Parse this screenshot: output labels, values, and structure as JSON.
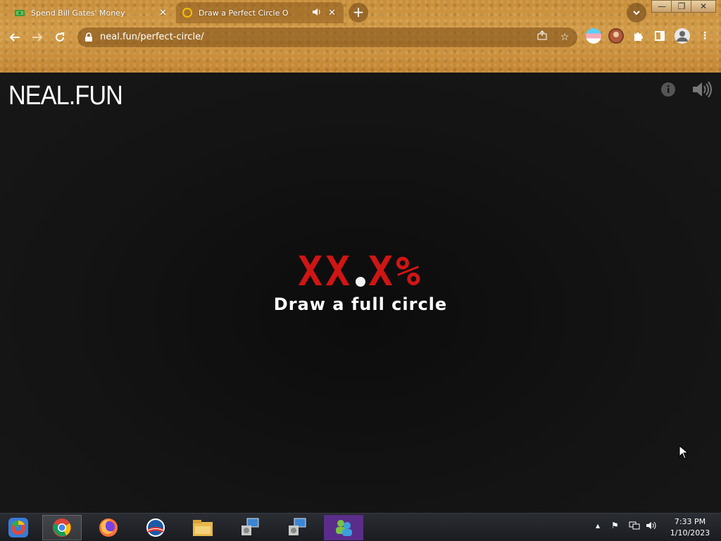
{
  "browser": {
    "tabs": [
      {
        "title": "Spend Bill Gates' Money",
        "close": "✕"
      },
      {
        "title": "Draw a Perfect Circle O",
        "close": "✕"
      }
    ],
    "new_tab": "+",
    "url": "neal.fun/perfect-circle/"
  },
  "page": {
    "logo": "NEAL.FUN",
    "score_left": "XX",
    "score_right": "X%",
    "prompt": "Draw a full circle"
  },
  "taskbar": {
    "time": "7:33 PM",
    "date": "1/10/2023"
  },
  "colors": {
    "score": "#d01515",
    "page_bg": "#101010"
  }
}
